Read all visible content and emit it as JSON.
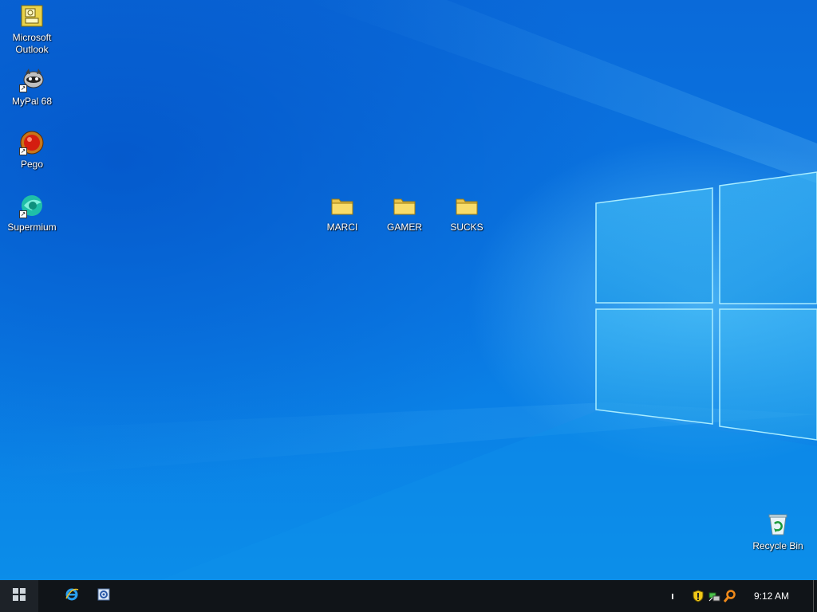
{
  "desktop": {
    "icons": [
      {
        "label": "Microsoft\nOutlook",
        "icon": "outlook-icon"
      },
      {
        "label": "MyPal 68",
        "icon": "mypal-icon"
      },
      {
        "label": "Pego",
        "icon": "pego-icon"
      },
      {
        "label": "Supermium",
        "icon": "supermium-icon"
      },
      {
        "label": "MARCI",
        "icon": "folder-icon"
      },
      {
        "label": "GAMER",
        "icon": "folder-icon"
      },
      {
        "label": "SUCKS",
        "icon": "folder-icon"
      },
      {
        "label": "Recycle Bin",
        "icon": "recycle-bin-icon"
      }
    ],
    "colors": {
      "wallpaper": "#0a74df",
      "glow": "#78dcff"
    }
  },
  "taskbar": {
    "start_icon": "windows-logo-icon",
    "pinned": [
      {
        "icon": "internet-explorer-icon"
      },
      {
        "icon": "settings-app-icon"
      }
    ],
    "tray": {
      "icons": [
        "tray-overflow-icon",
        "shield-icon",
        "network-icon",
        "search-icon"
      ],
      "clock": "9:12 AM"
    },
    "color": "#101418"
  }
}
